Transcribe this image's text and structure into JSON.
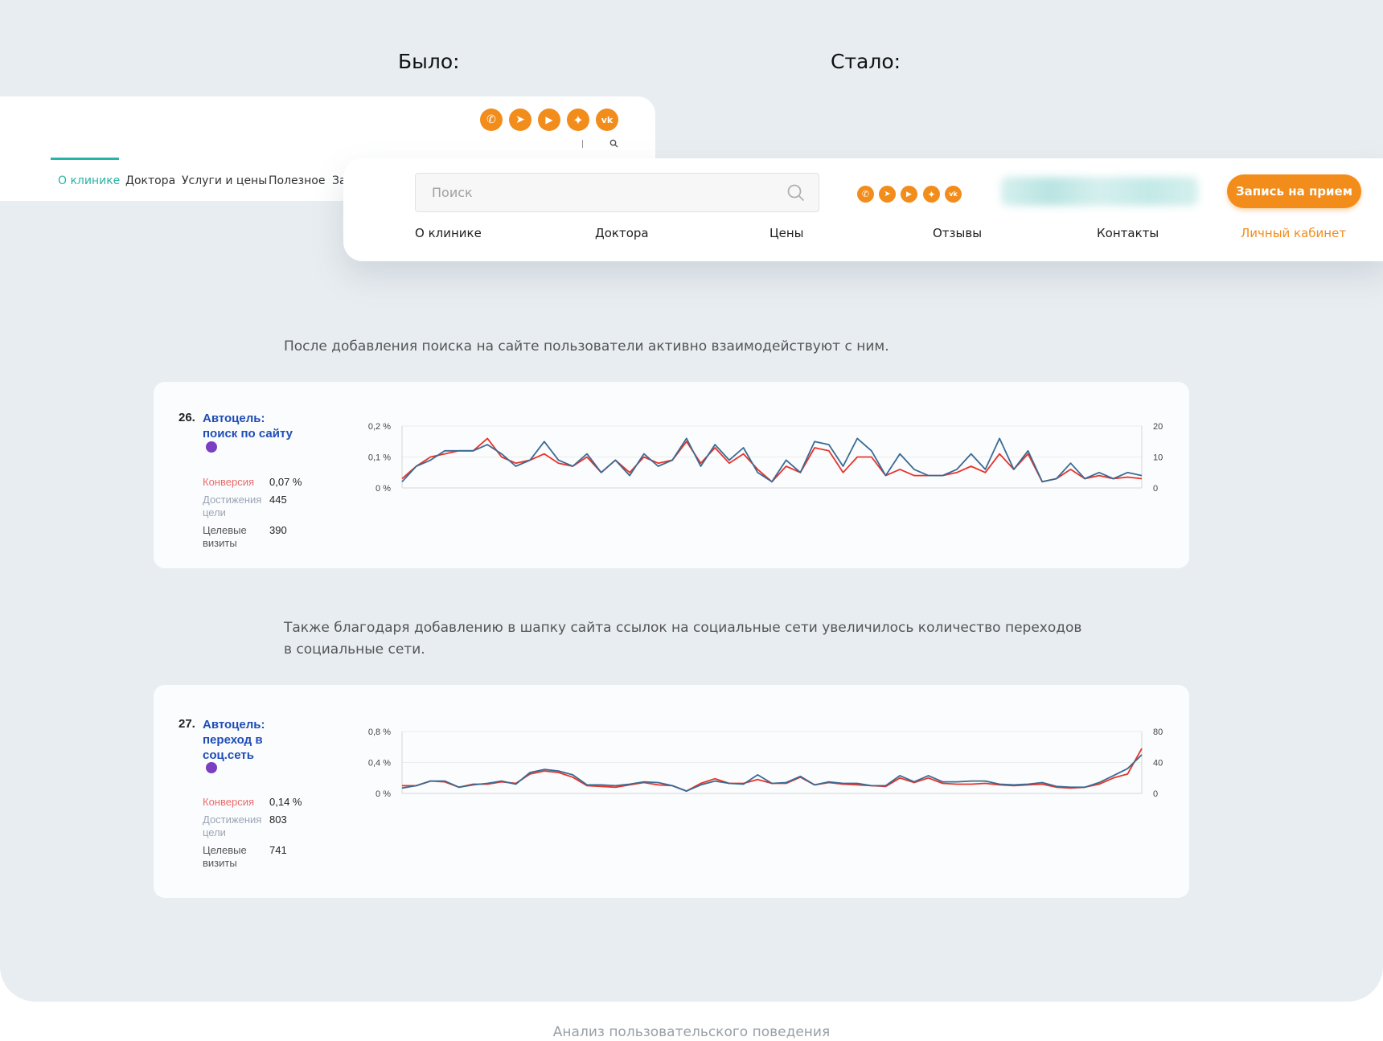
{
  "headings": {
    "before": "Было:",
    "after": "Стало:"
  },
  "before_header": {
    "nav": [
      "О клинике",
      "Доктора",
      "Услуги и цены",
      "Полезное",
      "За"
    ],
    "active_index": 0,
    "social_icons": [
      "whatsapp-icon",
      "telegram-icon",
      "youtube-icon",
      "zen-icon",
      "vk-icon"
    ]
  },
  "after_header": {
    "search_placeholder": "Поиск",
    "cta": "Запись на прием",
    "nav": [
      "О клинике",
      "Доктора",
      "Цены",
      "Отзывы",
      "Контакты",
      "Личный кабинет"
    ],
    "social_icons": [
      "whatsapp-icon",
      "telegram-icon",
      "youtube-icon",
      "zen-icon",
      "vk-icon"
    ],
    "accent": "#f28c1b"
  },
  "texts": {
    "p1": "После добавления поиска на сайте пользователи активно взаимодействуют с ним.",
    "p2_line1": "Также благодаря добавлению в шапку сайта ссылок на социальные сети увеличилось количество переходов",
    "p2_line2": "в социальные сети.",
    "footer": "Анализ пользовательского поведения"
  },
  "metrics": [
    {
      "num": "26.",
      "title_lines": [
        "Автоцель:",
        "поиск по сайту"
      ],
      "stats": [
        {
          "label_lines": [
            "Конверсия"
          ],
          "value": "0,07 %",
          "color": "#e86b6b"
        },
        {
          "label_lines": [
            "Достижения",
            "цели"
          ],
          "value": "445",
          "color": "#9aa6b6"
        },
        {
          "label_lines": [
            "Целевые",
            "визиты"
          ],
          "value": "390",
          "color": "#555555"
        }
      ]
    },
    {
      "num": "27.",
      "title_lines": [
        "Автоцель:",
        "переход в",
        "соц.сеть"
      ],
      "stats": [
        {
          "label_lines": [
            "Конверсия"
          ],
          "value": "0,14 %",
          "color": "#e86b6b"
        },
        {
          "label_lines": [
            "Достижения",
            "цели"
          ],
          "value": "803",
          "color": "#9aa6b6"
        },
        {
          "label_lines": [
            "Целевые",
            "визиты"
          ],
          "value": "741",
          "color": "#555555"
        }
      ]
    }
  ],
  "chart_data": [
    {
      "type": "line",
      "left_ticks": [
        "0 %",
        "0,1 %",
        "0,2 %"
      ],
      "right_ticks": [
        "0",
        "10",
        "20"
      ],
      "ylim": [
        0,
        0.2
      ],
      "y2lim": [
        0,
        20
      ],
      "grid": true,
      "series": [
        {
          "color": "#e8332a",
          "axis": "left",
          "values": [
            0.03,
            0.07,
            0.1,
            0.11,
            0.12,
            0.12,
            0.16,
            0.1,
            0.08,
            0.09,
            0.11,
            0.08,
            0.07,
            0.1,
            0.05,
            0.09,
            0.05,
            0.1,
            0.08,
            0.09,
            0.15,
            0.08,
            0.13,
            0.08,
            0.11,
            0.06,
            0.02,
            0.07,
            0.05,
            0.13,
            0.12,
            0.05,
            0.1,
            0.1,
            0.04,
            0.06,
            0.04,
            0.04,
            0.04,
            0.05,
            0.07,
            0.05,
            0.11,
            0.06,
            0.11,
            0.02,
            0.03,
            0.06,
            0.03,
            0.04,
            0.03,
            0.035,
            0.03
          ]
        },
        {
          "color": "#3a6a93",
          "axis": "right",
          "values": [
            2,
            7,
            9,
            12,
            12,
            12,
            14,
            11,
            7,
            9,
            15,
            9,
            7,
            11,
            5,
            9,
            4,
            11,
            7,
            9,
            16,
            7,
            14,
            9,
            13,
            5,
            2,
            9,
            5,
            15,
            14,
            7,
            16,
            12,
            4,
            11,
            6,
            4,
            4,
            6,
            11,
            6,
            16,
            6,
            12,
            2,
            3,
            8,
            3,
            5,
            3,
            5,
            4
          ]
        }
      ]
    },
    {
      "type": "line",
      "left_ticks": [
        "0 %",
        "0,4 %",
        "0,8 %"
      ],
      "right_ticks": [
        "0",
        "40",
        "80"
      ],
      "ylim": [
        0,
        0.8
      ],
      "y2lim": [
        0,
        80
      ],
      "grid": true,
      "series": [
        {
          "color": "#e8332a",
          "axis": "left",
          "values": [
            0.1,
            0.1,
            0.16,
            0.15,
            0.08,
            0.12,
            0.12,
            0.15,
            0.13,
            0.25,
            0.29,
            0.27,
            0.21,
            0.1,
            0.09,
            0.08,
            0.11,
            0.14,
            0.11,
            0.1,
            0.03,
            0.13,
            0.19,
            0.13,
            0.13,
            0.18,
            0.13,
            0.13,
            0.21,
            0.11,
            0.14,
            0.12,
            0.11,
            0.1,
            0.09,
            0.2,
            0.14,
            0.2,
            0.13,
            0.12,
            0.12,
            0.13,
            0.11,
            0.1,
            0.11,
            0.12,
            0.08,
            0.07,
            0.08,
            0.12,
            0.2,
            0.25,
            0.58
          ]
        },
        {
          "color": "#3a6a93",
          "axis": "right",
          "values": [
            7,
            10,
            16,
            16,
            8,
            11,
            13,
            16,
            12,
            27,
            31,
            29,
            24,
            11,
            11,
            10,
            12,
            15,
            14,
            10,
            3,
            11,
            16,
            13,
            12,
            24,
            13,
            14,
            22,
            11,
            15,
            13,
            13,
            10,
            10,
            23,
            15,
            23,
            15,
            15,
            16,
            16,
            12,
            11,
            12,
            14,
            9,
            8,
            8,
            14,
            23,
            32,
            50
          ]
        }
      ]
    }
  ]
}
